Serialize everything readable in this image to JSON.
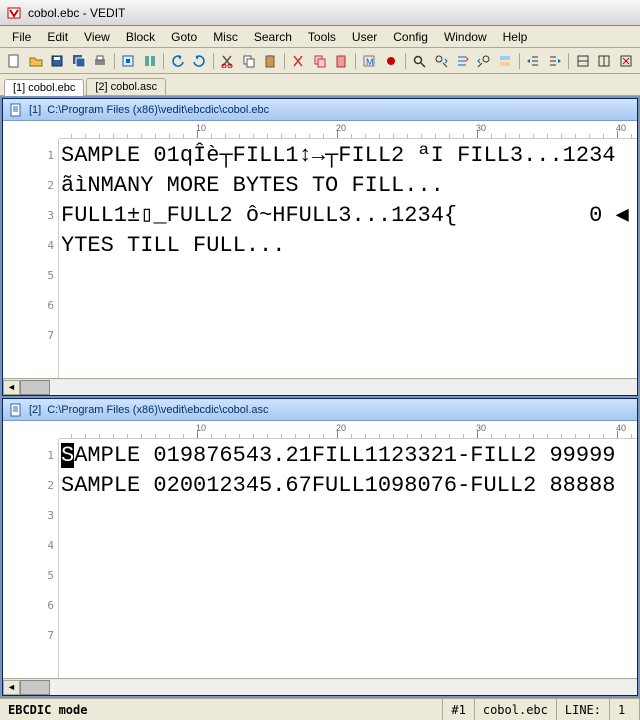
{
  "window": {
    "title": "cobol.ebc - VEDIT"
  },
  "menu": {
    "file": "File",
    "edit": "Edit",
    "view": "View",
    "block": "Block",
    "goto": "Goto",
    "misc": "Misc",
    "search": "Search",
    "tools": "Tools",
    "user": "User",
    "config": "Config",
    "window": "Window",
    "help": "Help"
  },
  "tabs": {
    "t1": "[1] cobol.ebc",
    "t2": "[2] cobol.asc"
  },
  "doc1": {
    "index": "[1]",
    "path": "C:\\Program Files (x86)\\vedit\\ebcdic\\cobol.ebc",
    "ruler": [
      "10",
      "20",
      "30",
      "40"
    ],
    "gutter": [
      "1",
      "2",
      "3",
      "4",
      "5",
      "6",
      "7"
    ],
    "lines": {
      "l1": "SAMPLE 01qÎè┬FILL1↕→┬FILL2 ªI FILL3...1234",
      "l2": "ãìNMANY MORE BYTES TO FILL...",
      "l3": "FULL1±▯_FULL2 ô~HFULL3...1234{          0 ◀",
      "l4": "YTES TILL FULL..."
    }
  },
  "doc2": {
    "index": "[2]",
    "path": "C:\\Program Files (x86)\\vedit\\ebcdic\\cobol.asc",
    "ruler": [
      "10",
      "20",
      "30",
      "40"
    ],
    "gutter": [
      "1",
      "2",
      "3",
      "4",
      "5",
      "6",
      "7"
    ],
    "lines": {
      "l1_first": "S",
      "l1_rest": "AMPLE 019876543.21FILL1123321-FILL2 99999",
      "l2": "SAMPLE 020012345.67FULL1098076-FULL2 88888"
    }
  },
  "status": {
    "mode": "EBCDIC mode",
    "buf": "#1",
    "file": "cobol.ebc",
    "line_label": "LINE:",
    "line_val": "1"
  }
}
